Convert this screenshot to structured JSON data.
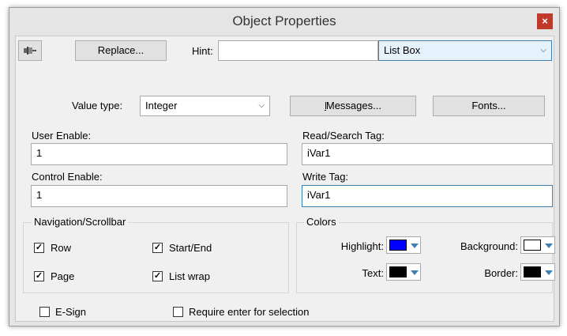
{
  "window": {
    "title": "Object Properties",
    "close_glyph": "×"
  },
  "toolbar": {
    "pin_icon": "pin-icon",
    "replace_label": "Replace...",
    "hint_label": "Hint:",
    "hint_value": "",
    "object_type": "List Box"
  },
  "value_type": {
    "label": "Value type:",
    "value": "Integer"
  },
  "buttons": {
    "messages": "Messages...",
    "fonts": "Fonts..."
  },
  "user_enable": {
    "label": "User Enable:",
    "value": "1"
  },
  "control_enable": {
    "label": "Control Enable:",
    "value": "1"
  },
  "read_tag": {
    "label": "Read/Search Tag:",
    "value": "iVar1"
  },
  "write_tag": {
    "label": "Write Tag:",
    "value": "iVar1"
  },
  "navigation": {
    "title": "Navigation/Scrollbar",
    "row": {
      "label": "Row",
      "checked": true
    },
    "page": {
      "label": "Page",
      "checked": true
    },
    "start_end": {
      "label": "Start/End",
      "checked": true
    },
    "list_wrap": {
      "label": "List wrap",
      "checked": true
    }
  },
  "colors": {
    "title": "Colors",
    "highlight": {
      "label": "Highlight:",
      "color": "#0000ff"
    },
    "text": {
      "label": "Text:",
      "color": "#000000"
    },
    "background": {
      "label": "Background:",
      "color": "#ffffff"
    },
    "border": {
      "label": "Border:",
      "color": "#000000"
    }
  },
  "esign": {
    "label": "E-Sign",
    "checked": false
  },
  "require_enter": {
    "label": "Require enter for selection",
    "checked": false
  },
  "check_glyph": "✓"
}
